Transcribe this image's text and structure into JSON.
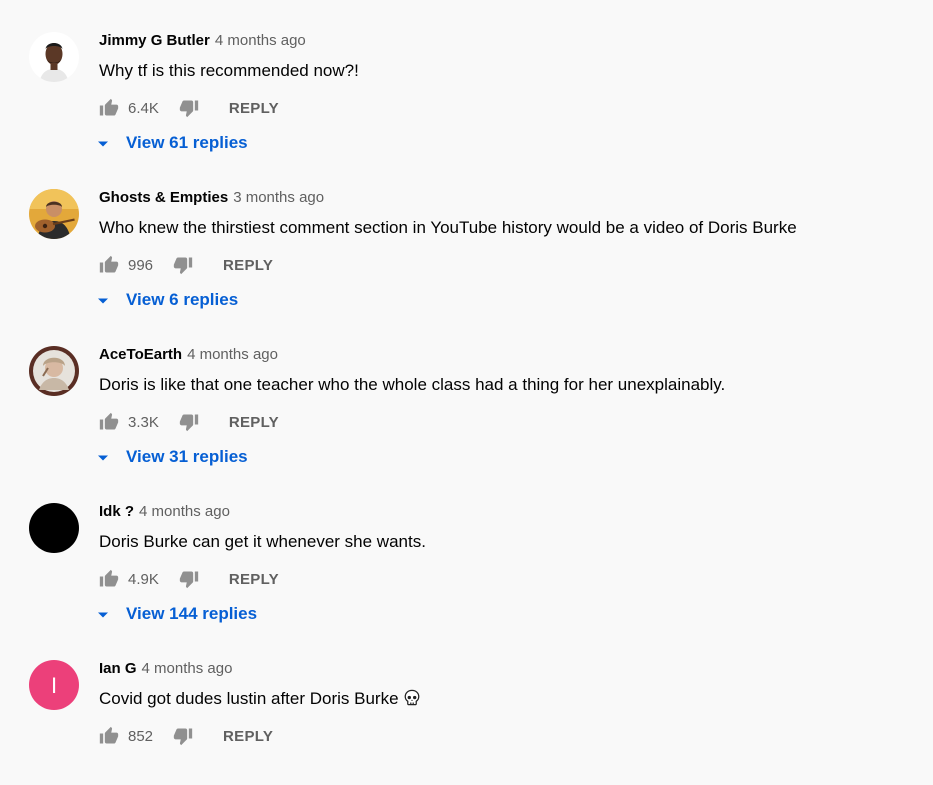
{
  "comments": [
    {
      "author": "Jimmy G Butler",
      "time": "4 months ago",
      "text": "Why tf is this recommended now?!",
      "likes": "6.4K",
      "reply_label": "REPLY",
      "replies_label": "View 61 replies",
      "avatar": {
        "kind": "photo",
        "icon": "person-avatar",
        "bg": "#ffffff"
      }
    },
    {
      "author": "Ghosts & Empties",
      "time": "3 months ago",
      "text": "Who knew the thirstiest comment section in YouTube history would be a video of Doris Burke",
      "likes": "996",
      "reply_label": "REPLY",
      "replies_label": "View 6 replies",
      "avatar": {
        "kind": "photo",
        "icon": "guitar-player-avatar",
        "bg": "#e3a83a"
      }
    },
    {
      "author": "AceToEarth",
      "time": "4 months ago",
      "text": "Doris is like that one teacher who the whole class had a thing for her unexplainably.",
      "likes": "3.3K",
      "reply_label": "REPLY",
      "replies_label": "View 31 replies",
      "avatar": {
        "kind": "photo",
        "icon": "framed-portrait-avatar",
        "bg": "#5a2e24"
      }
    },
    {
      "author": "Idk ?",
      "time": "4 months ago",
      "text": "Doris Burke can get it whenever she wants.",
      "likes": "4.9K",
      "reply_label": "REPLY",
      "replies_label": "View 144 replies",
      "avatar": {
        "kind": "solid",
        "icon": "black-avatar",
        "bg": "#000000"
      }
    },
    {
      "author": "Ian G",
      "time": "4 months ago",
      "text": "Covid got dudes lustin after Doris Burke",
      "text_emoji": "skull-emoji",
      "likes": "852",
      "reply_label": "REPLY",
      "avatar": {
        "kind": "letter",
        "letter": "I",
        "icon": "letter-avatar",
        "bg": "#ec407a"
      }
    }
  ],
  "colors": {
    "link": "#065fd4",
    "muted": "#606060",
    "text": "#030303",
    "background": "#f9f9f9"
  }
}
